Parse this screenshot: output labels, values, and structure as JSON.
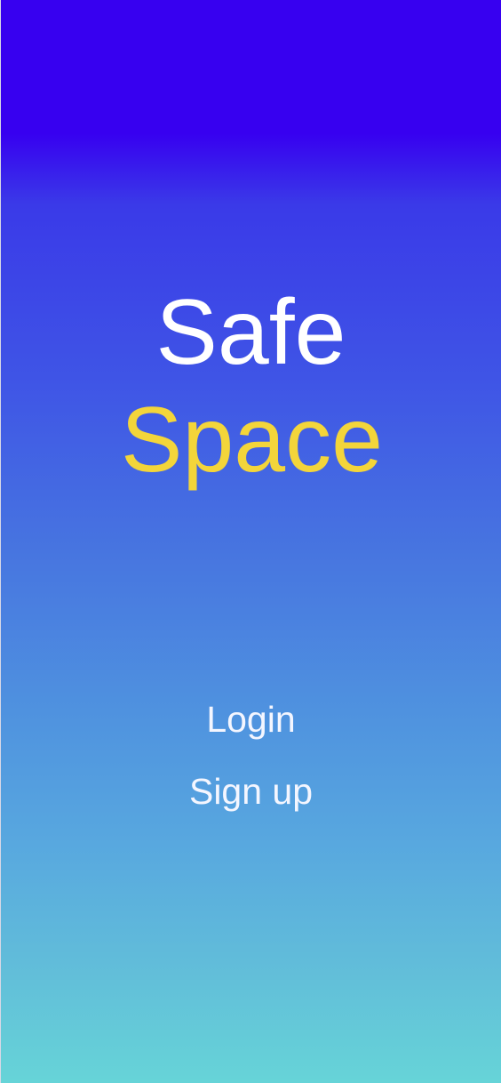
{
  "app": {
    "title_line1": "Safe",
    "title_line2": "Space"
  },
  "actions": {
    "login_label": "Login",
    "signup_label": "Sign up"
  },
  "colors": {
    "gradient_top": "#3700f0",
    "gradient_bottom": "#66d4d8",
    "title_primary": "#ffffff",
    "title_accent": "#f3d53a",
    "link_text": "#f4f6ff"
  }
}
